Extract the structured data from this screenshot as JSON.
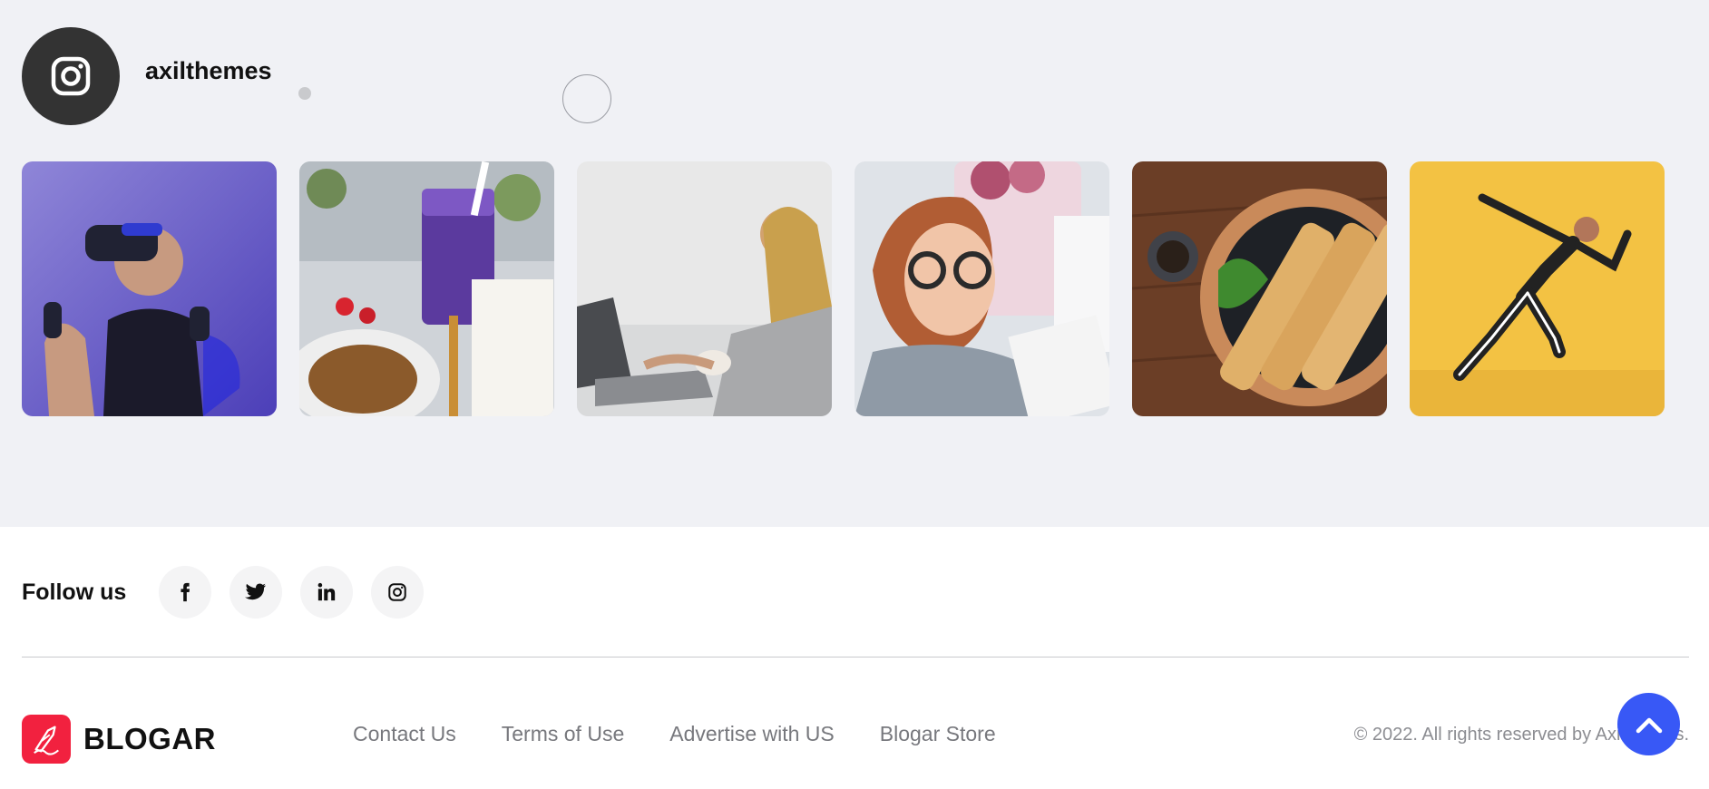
{
  "instagram": {
    "handle": "axilthemes",
    "icon": "instagram-icon",
    "posts": [
      {
        "subject": "vr-headset",
        "bg": "#7b6fd0"
      },
      {
        "subject": "purple-smoothie",
        "bg": "#d8dbe0"
      },
      {
        "subject": "woman-laptop",
        "bg": "#e9e9ea"
      },
      {
        "subject": "woman-glasses",
        "bg": "#d6dbe2"
      },
      {
        "subject": "skewers",
        "bg": "#6b3e26"
      },
      {
        "subject": "runner",
        "bg": "#f3c243"
      }
    ]
  },
  "footer": {
    "follow_label": "Follow us",
    "socials": [
      {
        "name": "facebook-icon",
        "glyph": "f"
      },
      {
        "name": "twitter-icon",
        "glyph": "t"
      },
      {
        "name": "linkedin-icon",
        "glyph": "in"
      },
      {
        "name": "instagram-icon",
        "glyph": "ig"
      }
    ],
    "brand_name": "BLOGAR",
    "links": [
      "Contact Us",
      "Terms of Use",
      "Advertise with US",
      "Blogar Store"
    ],
    "copyright": "© 2022. All rights reserved by Axilthemes."
  },
  "colors": {
    "section_bg": "#f0f1f5",
    "brand_red": "#f2213f",
    "accent_blue": "#3858f6",
    "link_gray": "#77787d"
  }
}
